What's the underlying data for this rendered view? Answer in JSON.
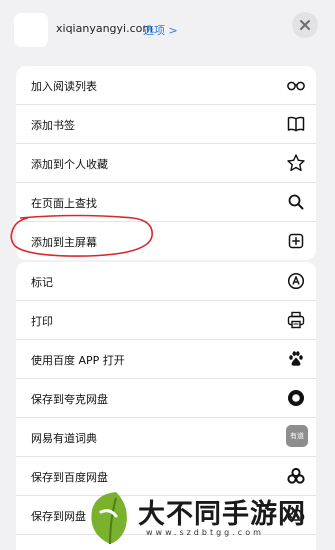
{
  "header": {
    "site_name": "xiqianyangyi.com",
    "options_label": "选项 >"
  },
  "group1": [
    {
      "label": "加入阅读列表",
      "icon": "glasses-icon"
    },
    {
      "label": "添加书签",
      "icon": "book-icon"
    },
    {
      "label": "添加到个人收藏",
      "icon": "star-icon"
    },
    {
      "label": "在页面上查找",
      "icon": "search-icon"
    },
    {
      "label": "添加到主屏幕",
      "icon": "add-square-icon"
    }
  ],
  "group2": [
    {
      "label": "标记",
      "icon": "markup-icon"
    },
    {
      "label": "打印",
      "icon": "printer-icon"
    },
    {
      "label": "使用百度 APP 打开",
      "icon": "baidu-paw-icon"
    },
    {
      "label": "保存到夸克网盘",
      "icon": "quark-icon"
    },
    {
      "label": "网易有道词典",
      "icon": "youdao-icon",
      "icon_text": "有道"
    },
    {
      "label": "保存到百度网盘",
      "icon": "baidu-pan-icon"
    },
    {
      "label": "保存到网盘",
      "icon": "cloud-icon"
    }
  ],
  "watermark": {
    "text": "大不同手游网",
    "url": "www.szdbtgg.com"
  },
  "colors": {
    "link": "#2f7de1",
    "highlight": "#d8282a",
    "background": "#f1f1f4",
    "watermark_green": "#7ab22e"
  }
}
